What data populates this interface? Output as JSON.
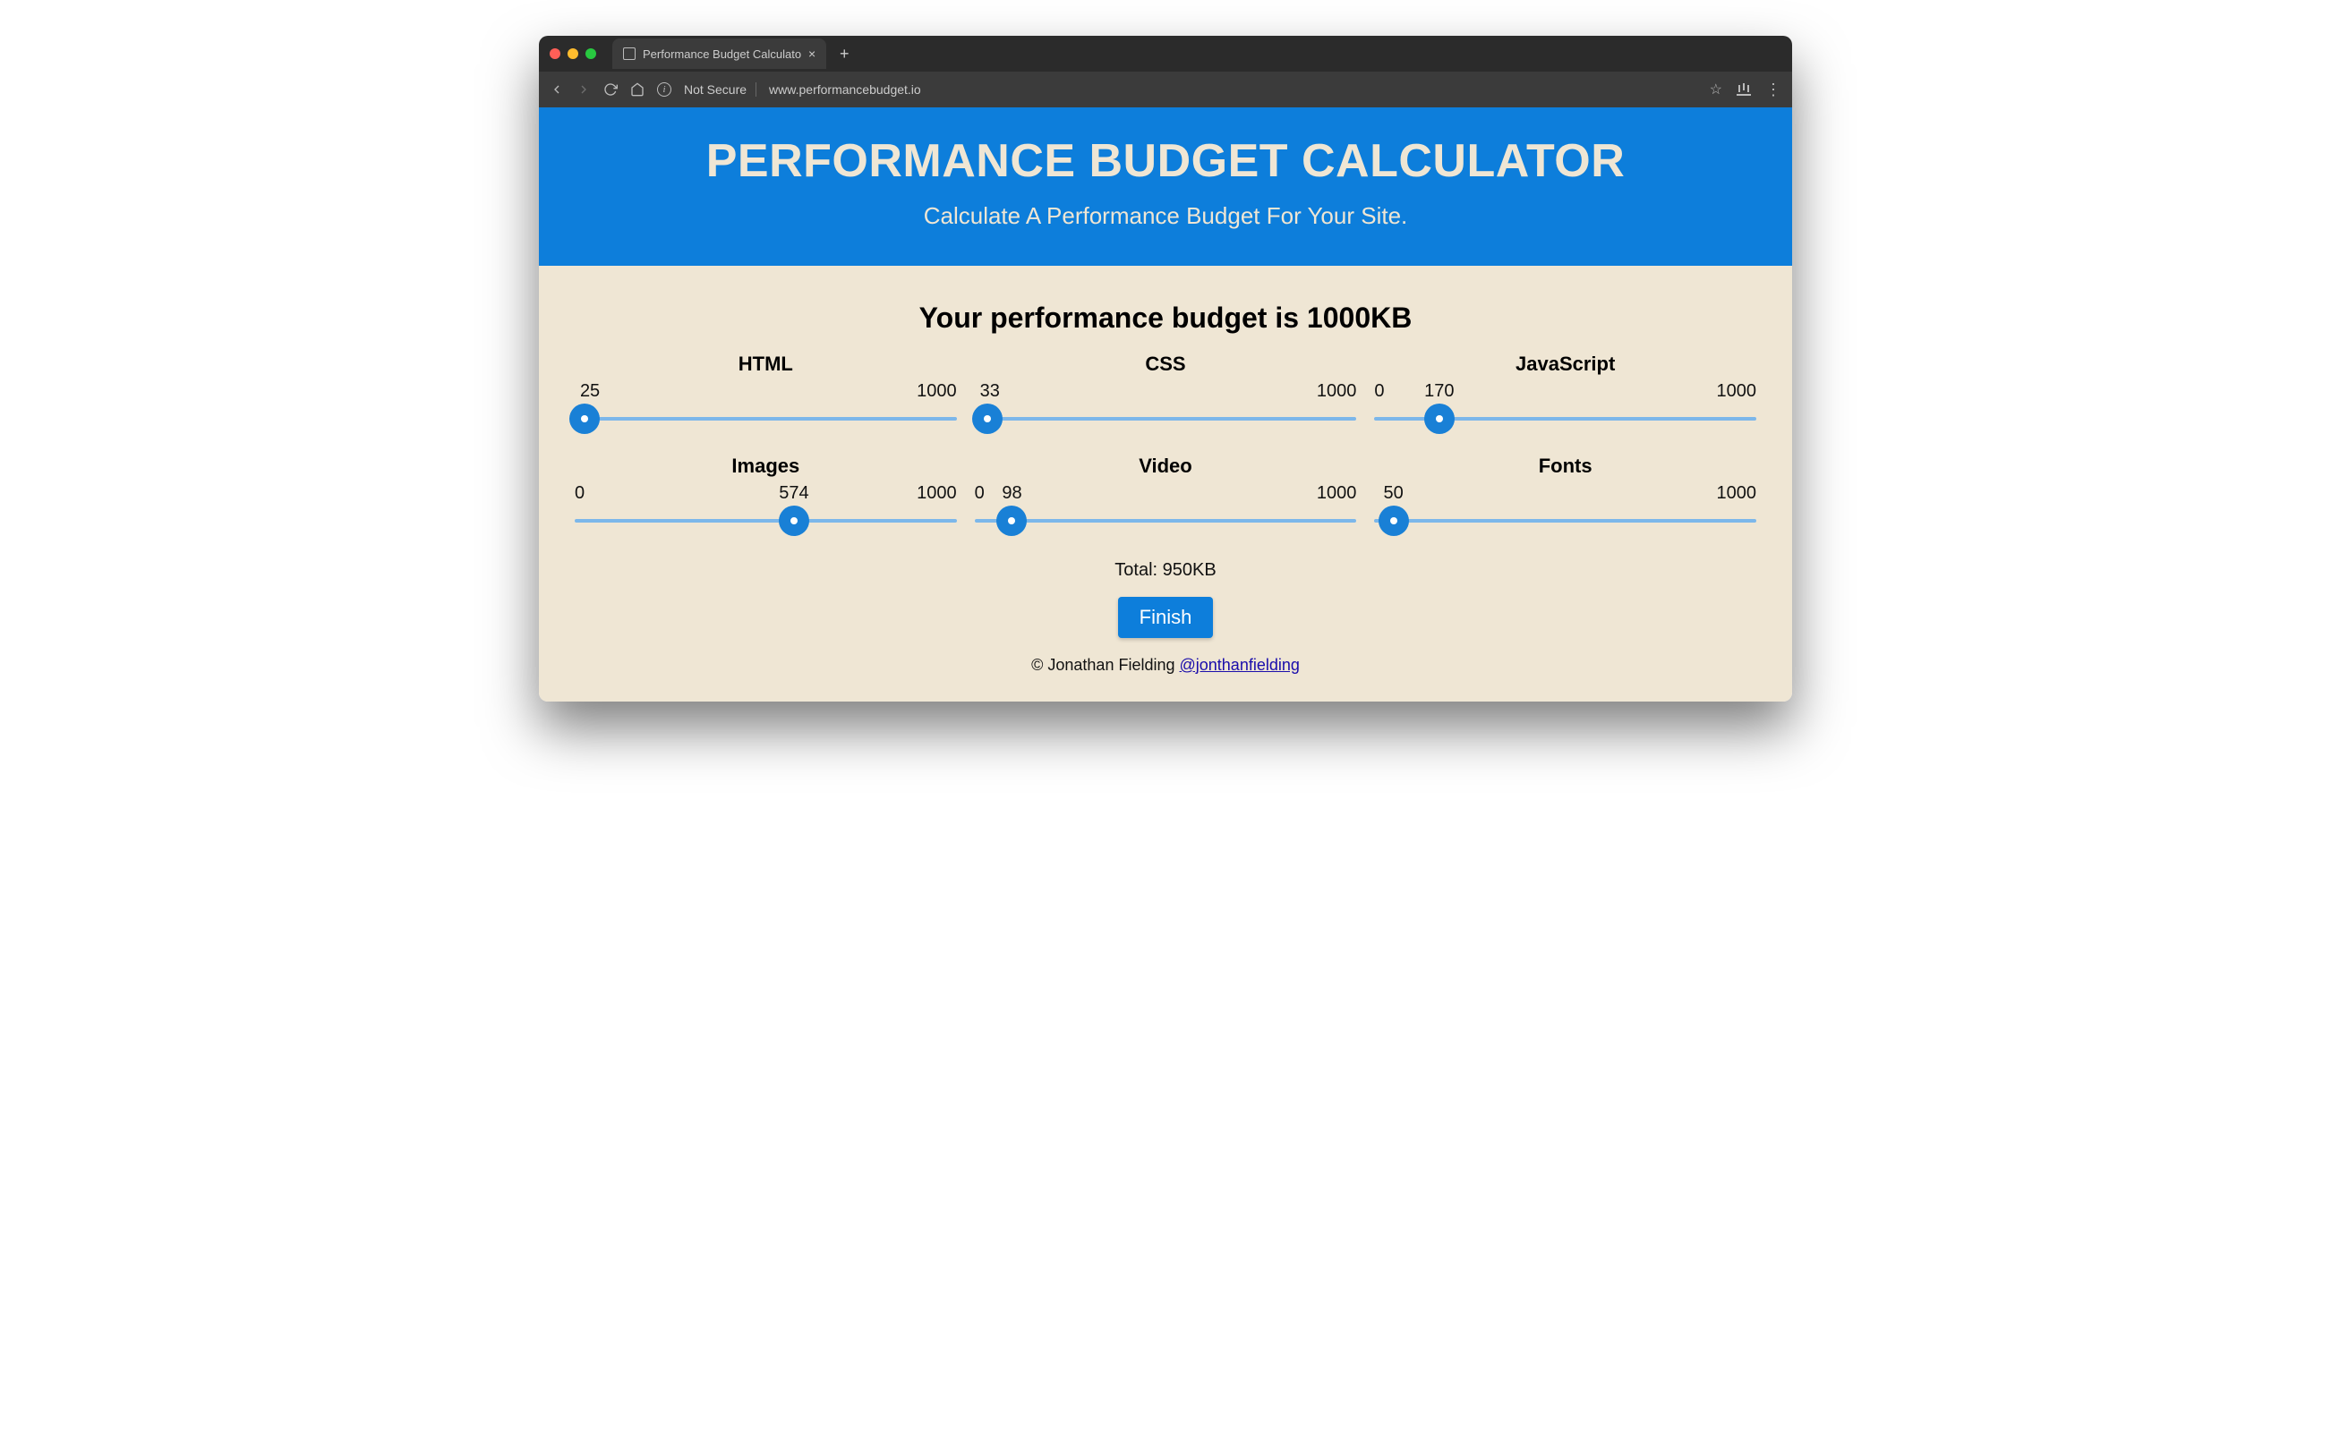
{
  "browser": {
    "tab_title": "Performance Budget Calculato",
    "security_label": "Not Secure",
    "url": "www.performancebudget.io"
  },
  "hero": {
    "title": "PERFORMANCE BUDGET CALCULATOR",
    "subtitle": "Calculate A Performance Budget For Your Site."
  },
  "budget": {
    "heading": "Your performance budget is 1000KB",
    "total_label": "Total: 950KB"
  },
  "sliders": [
    {
      "name": "HTML",
      "min": 0,
      "value": 25,
      "max": 1000,
      "show_min": false
    },
    {
      "name": "CSS",
      "min": 0,
      "value": 33,
      "max": 1000,
      "show_min": false
    },
    {
      "name": "JavaScript",
      "min": 0,
      "value": 170,
      "max": 1000,
      "show_min": true
    },
    {
      "name": "Images",
      "min": 0,
      "value": 574,
      "max": 1000,
      "show_min": true
    },
    {
      "name": "Video",
      "min": 0,
      "value": 98,
      "max": 1000,
      "show_min": true
    },
    {
      "name": "Fonts",
      "min": 0,
      "value": 50,
      "max": 1000,
      "show_min": false
    }
  ],
  "actions": {
    "finish": "Finish"
  },
  "footer": {
    "text": "© Jonathan Fielding ",
    "link_text": "@jonthanfielding"
  }
}
